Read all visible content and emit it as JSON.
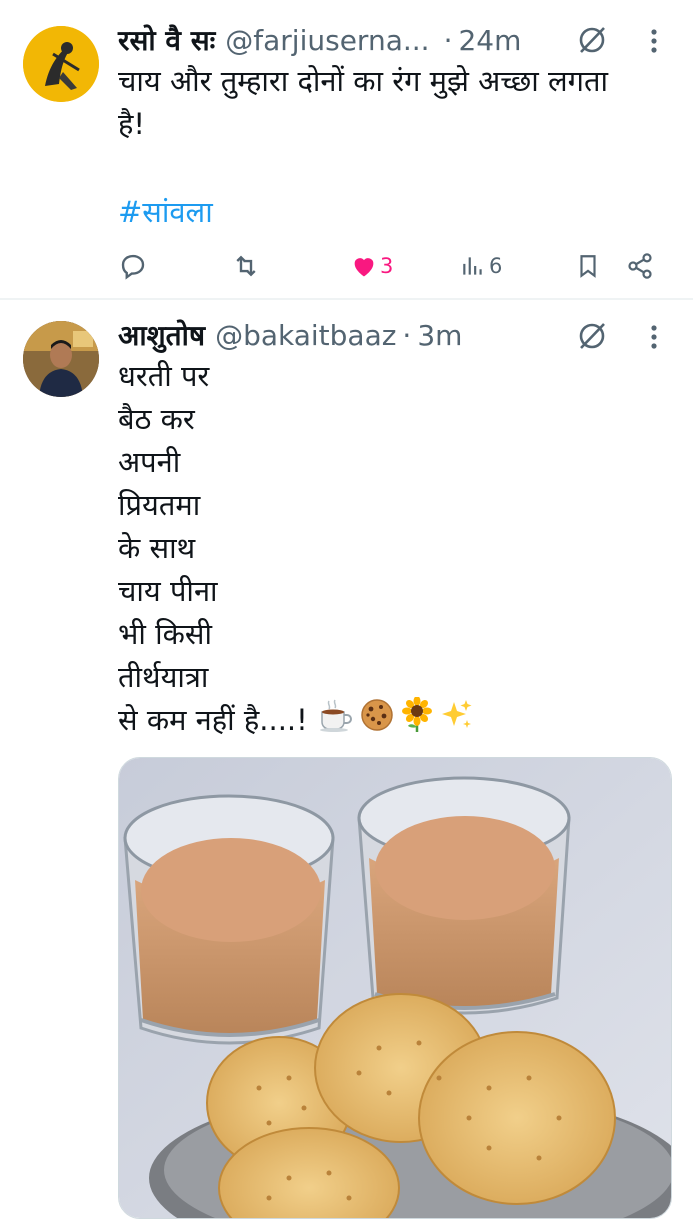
{
  "tweets": [
    {
      "display_name": "रसो वै सः",
      "handle": "@farjiuserna...",
      "separator": "·",
      "time": "24m",
      "text_lines": [
        "चाय और तुम्हारा दोनों का रंग मुझे अच्छा लगता",
        "है!"
      ],
      "hashtag": "#सांवला",
      "actions": {
        "reply_count": "",
        "retweet_count": "",
        "like_count": "3",
        "views_count": "6"
      },
      "liked": true
    },
    {
      "display_name": "आशुतोष",
      "handle": "@bakaitbaaz",
      "separator": "·",
      "time": "3m",
      "text_lines": [
        "धरती पर",
        "बैठ कर",
        "अपनी",
        "प्रियतमा",
        "के साथ",
        "चाय पीना",
        "भी किसी",
        "तीर्थयात्रा",
        "से कम नहीं है....!"
      ],
      "emojis": [
        "hot-beverage",
        "cookie",
        "sunflower",
        "sparkles"
      ],
      "image": "two glasses of tea with biscuits"
    }
  ],
  "icons": {
    "reply": "reply-icon",
    "retweet": "retweet-icon",
    "like": "heart-icon",
    "views": "views-icon",
    "bookmark": "bookmark-icon",
    "share": "share-icon",
    "grok": "grok-icon",
    "more": "more-icon"
  },
  "colors": {
    "link": "#1d9bf0",
    "like": "#f91880",
    "secondary_text": "#536471",
    "divider": "#eff3f4"
  }
}
